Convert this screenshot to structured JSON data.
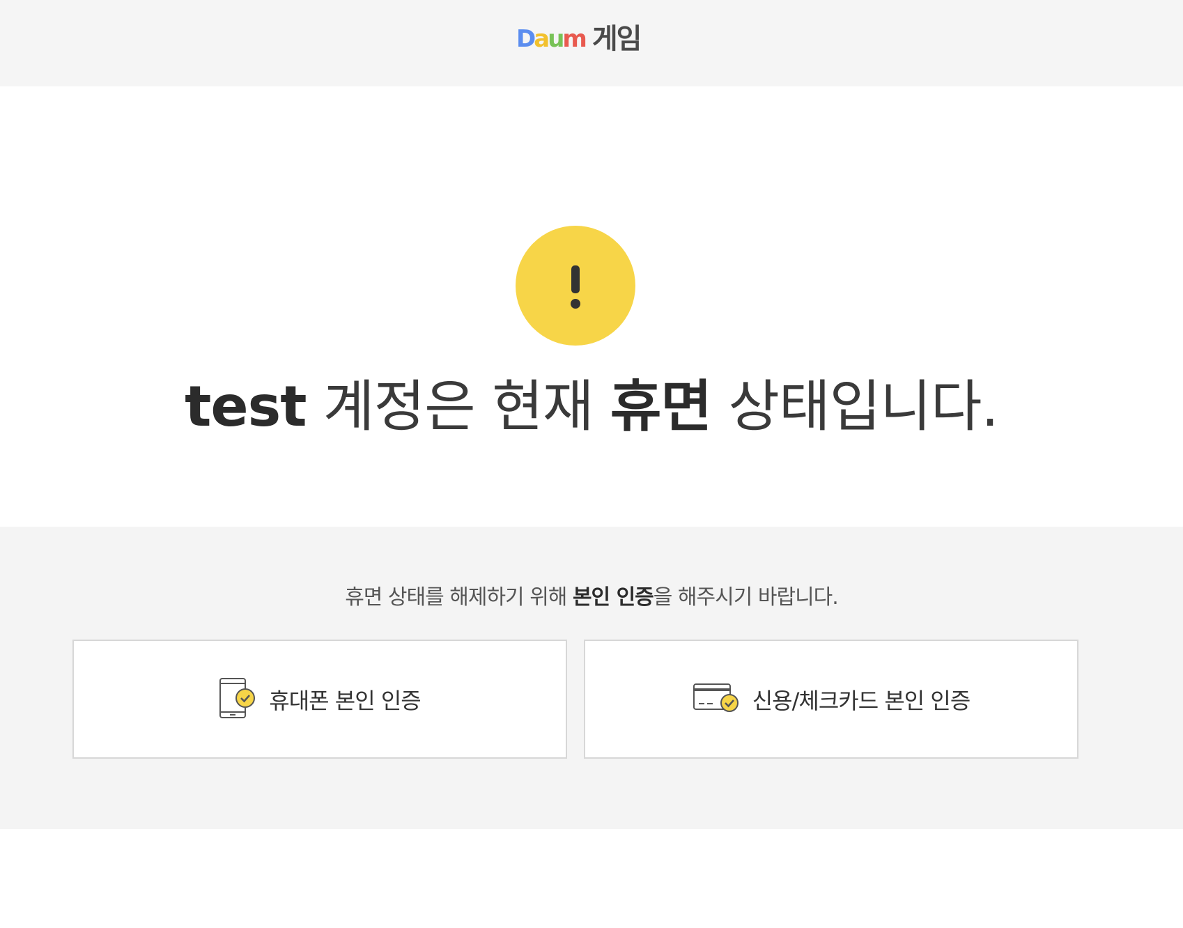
{
  "header": {
    "logo": {
      "mark_letters": [
        {
          "char": "D",
          "color": "#5b8def"
        },
        {
          "char": "a",
          "color": "#f2c12e"
        },
        {
          "char": "u",
          "color": "#78c257"
        },
        {
          "char": "m",
          "color": "#e85a4f"
        }
      ],
      "service_text": "게임"
    }
  },
  "hero": {
    "icon": "exclamation-icon",
    "icon_color": "#f7d548",
    "headline": {
      "account": "test",
      "part1": " 계정은 현재 ",
      "status": "휴면",
      "part2": " 상태입니다."
    }
  },
  "verify": {
    "instruction": {
      "prefix": "휴면 상태를 해제하기 위해 ",
      "emphasis": "본인 인증",
      "suffix": "을 해주시기 바랍니다."
    },
    "options": [
      {
        "label": "휴대폰 본인 인증",
        "icon": "phone-check-icon"
      },
      {
        "label": "신용/체크카드 본인 인증",
        "icon": "card-check-icon"
      }
    ],
    "accent_color": "#f7d548"
  }
}
